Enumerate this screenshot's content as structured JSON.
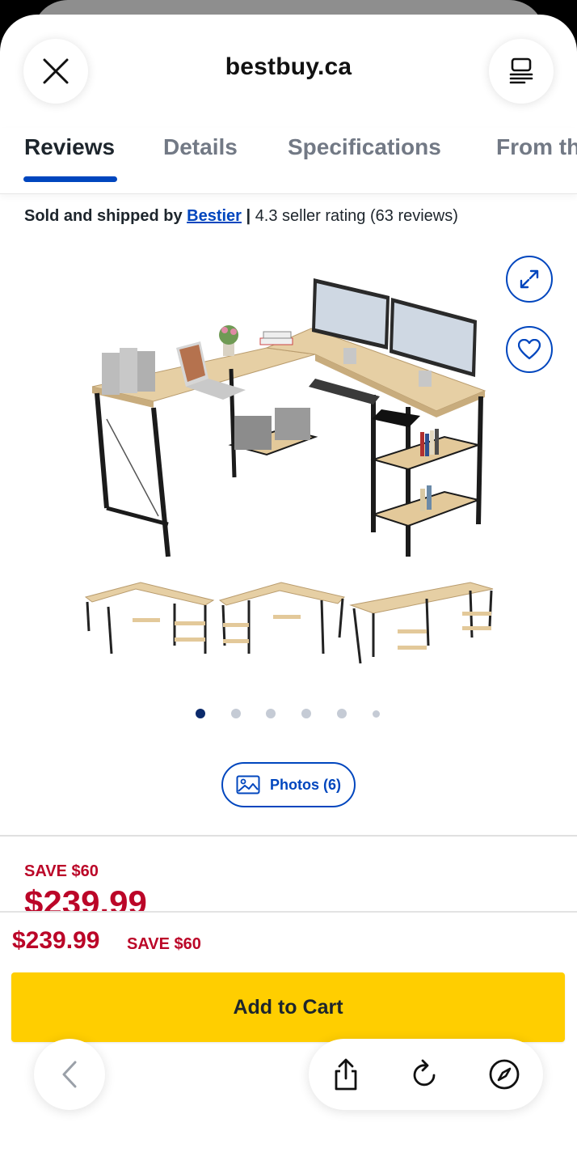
{
  "browser": {
    "url": "bestbuy.ca"
  },
  "tabs": [
    {
      "label": "Reviews",
      "active": true
    },
    {
      "label": "Details",
      "active": false
    },
    {
      "label": "Specifications",
      "active": false
    },
    {
      "label": "From th",
      "active": false
    }
  ],
  "seller": {
    "prefix": "Sold and shipped by",
    "name": "Bestier",
    "separator": "|",
    "rating_text": "4.3 seller rating (63 reviews)"
  },
  "gallery": {
    "total_dots": 6,
    "active_index": 0,
    "photos_button_label": "Photos (6)"
  },
  "pricing": {
    "save_label": "SAVE $60",
    "price": "$239.99"
  },
  "sticky_bar": {
    "price": "$239.99",
    "save_label": "SAVE $60",
    "add_to_cart_label": "Add to Cart"
  },
  "colors": {
    "brand_blue": "#0046be",
    "sale_red": "#bb0628",
    "cart_yellow": "#ffce00"
  },
  "icons": [
    "close-icon",
    "reader-icon",
    "expand-icon",
    "heart-icon",
    "image-icon",
    "back-chevron-icon",
    "share-icon",
    "reload-icon",
    "compass-icon"
  ]
}
